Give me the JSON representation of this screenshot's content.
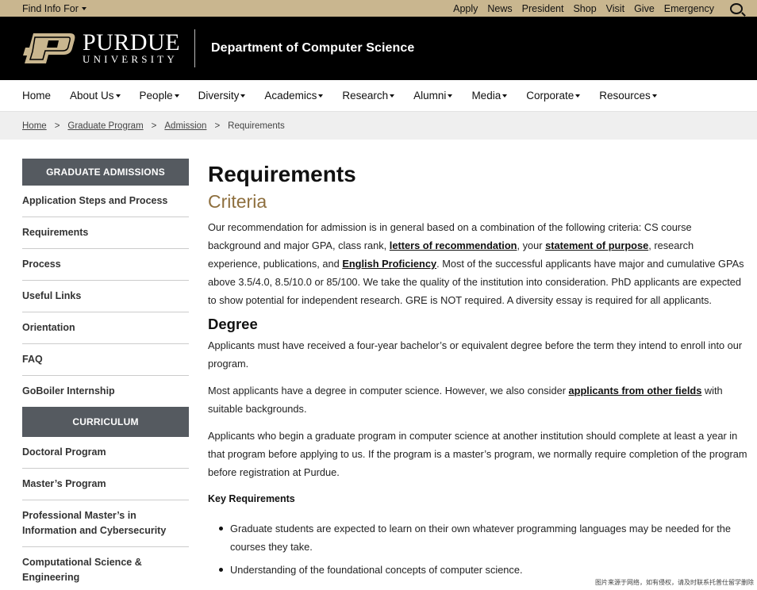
{
  "utility": {
    "find_info": "Find Info For",
    "links": [
      "Apply",
      "News",
      "President",
      "Shop",
      "Visit",
      "Give",
      "Emergency"
    ]
  },
  "header": {
    "wordmark_top": "PURDUE",
    "wordmark_bottom": "UNIVERSITY",
    "department": "Department of Computer Science"
  },
  "nav": {
    "items": [
      "Home",
      "About Us",
      "People",
      "Diversity",
      "Academics",
      "Research",
      "Alumni",
      "Media",
      "Corporate",
      "Resources"
    ]
  },
  "breadcrumb": {
    "items": [
      "Home",
      "Graduate Program",
      "Admission"
    ],
    "current": "Requirements",
    "separator": ">"
  },
  "sidebar": {
    "section1_title": "GRADUATE ADMISSIONS",
    "section1_items": [
      "Application Steps and Process",
      "Requirements",
      "Process",
      "Useful Links",
      "Orientation",
      "FAQ",
      "GoBoiler Internship"
    ],
    "section2_title": "CURRICULUM",
    "section2_items": [
      "Doctoral Program",
      "Master’s Program",
      "Professional Master’s in Information and Cybersecurity",
      "Computational Science & Engineering"
    ]
  },
  "main": {
    "title": "Requirements",
    "criteria_heading": "Criteria",
    "criteria_p": {
      "t1": "Our recommendation for admission is in general based on a combination of the following criteria: CS course background and major GPA, class rank, ",
      "l1": "letters of recommendation",
      "t2": ", your ",
      "l2": "statement of purpose",
      "t3": ", research experience, publications, and ",
      "l3": "English Proficiency",
      "t4": ". Most of the successful applicants have major and cumulative GPAs above 3.5/4.0, 8.5/10.0 or 85/100. We take the quality of the institution into consideration. PhD applicants are expected to show potential for independent research. GRE is NOT required. A diversity essay is required for all applicants."
    },
    "degree_heading": "Degree",
    "degree_p1": "Applicants must have received a four-year bachelor’s or equivalent degree before the term they intend to enroll into our program.",
    "degree_p2": {
      "t1": "Most applicants have a degree in computer science. However, we also consider ",
      "l1": "applicants from other fields",
      "t2": " with suitable backgrounds."
    },
    "degree_p3": "Applicants who begin a graduate program in computer science at another institution should complete at least a year in that program before applying to us. If the program is a master’s program, we normally require completion of the program before registration at Purdue.",
    "key_heading": "Key Requirements",
    "key_items": [
      "Graduate students are expected to learn on their own whatever programming languages may be needed for the courses they take.",
      "Understanding of the foundational concepts of computer science."
    ]
  },
  "watermark": "图片来源于网络，如有侵权，请及时联系托普仕留学删除",
  "colors": {
    "gold": "#c9b68f",
    "heading_gold": "#8e6f3e",
    "sidebar_head": "#555a60"
  }
}
